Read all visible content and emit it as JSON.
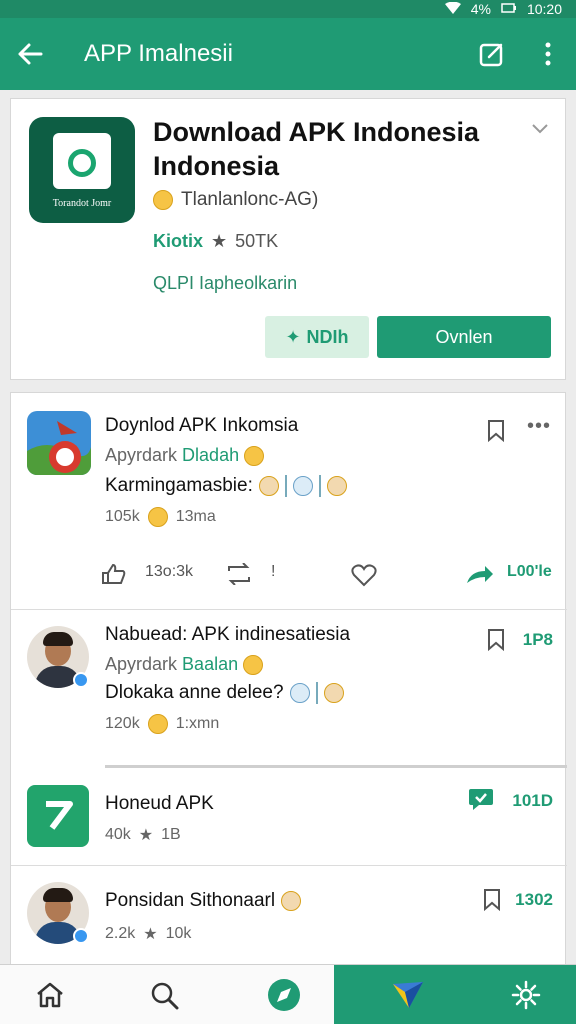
{
  "status_bar": {
    "battery": "4%",
    "time": "10:20"
  },
  "app_bar": {
    "title": "APP Imalnesii"
  },
  "hero": {
    "title": "Download APK Indonesia Indonesia",
    "icon_caption": "Torandot Jomr",
    "developer": "Tlanlanlonc-AG)",
    "rating": "Kiotix",
    "downloads": "50TK",
    "info": "QLPI Iapheolkarin",
    "secondary_button": "NDIh",
    "primary_button": "Ovnlen"
  },
  "posts": [
    {
      "title": "Doynlod APK Inkomsia",
      "sub_prefix": "Apyrdark",
      "sub_highlight": "Dladah",
      "line": "Karmingamasbie:",
      "meta_left": "105k",
      "meta_right": "13ma",
      "action_count": "13o:3k",
      "action_mid": "!",
      "action_right": "L00'le"
    },
    {
      "title": "Nabuead: APK indinesatiesia",
      "sub_prefix": "Apyrdark",
      "sub_highlight": "Baalan",
      "line": "Dlokaka anne delee?",
      "meta_left": "120k",
      "meta_right": "1:xmn",
      "side_count": "1P8"
    },
    {
      "title": "Honeud APK",
      "meta_left": "40k",
      "meta_right": "1B",
      "side_count": "101D"
    },
    {
      "title": "Ponsidan Sithonaarl",
      "meta_left": "2.2k",
      "meta_right": "10k",
      "side_count": "1302"
    }
  ],
  "colors": {
    "primary": "#1f9b74",
    "status": "#1f8a66"
  },
  "icons": [
    "back-arrow-icon",
    "edit-icon",
    "more-vertical-icon",
    "bookmark-icon",
    "heart-icon",
    "share-icon",
    "home-icon",
    "search-icon",
    "compass-icon",
    "send-icon",
    "gear-icon"
  ]
}
